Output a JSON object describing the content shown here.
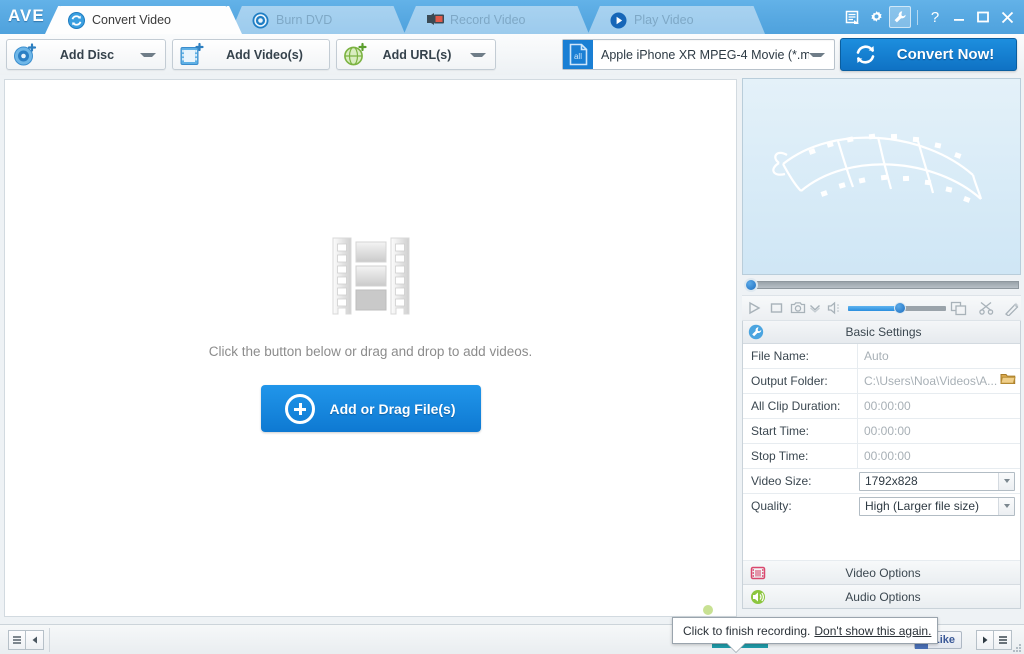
{
  "app": {
    "logo": "AVE"
  },
  "tabs": [
    {
      "label": "Convert Video",
      "icon": "convert-icon",
      "active": true
    },
    {
      "label": "Burn DVD",
      "icon": "disc-icon",
      "active": false
    },
    {
      "label": "Record Video",
      "icon": "camcorder-icon",
      "active": false
    },
    {
      "label": "Play Video",
      "icon": "play-icon",
      "active": false
    }
  ],
  "window_controls": [
    {
      "name": "log-icon",
      "glyph": "log"
    },
    {
      "name": "settings-gear-icon",
      "glyph": "gear"
    },
    {
      "name": "wrench-icon",
      "glyph": "wrench",
      "pressed": true
    },
    {
      "name": "help-icon",
      "glyph": "?"
    },
    {
      "name": "minimize-icon",
      "glyph": "—"
    },
    {
      "name": "maximize-icon",
      "glyph": "□"
    },
    {
      "name": "close-icon",
      "glyph": "✕"
    }
  ],
  "toolbar": {
    "add_disc": {
      "label": "Add Disc",
      "icon": "disc-plus-icon",
      "has_caret": true
    },
    "add_videos": {
      "label": "Add Video(s)",
      "icon": "film-plus-icon",
      "has_caret": false
    },
    "add_urls": {
      "label": "Add URL(s)",
      "icon": "globe-plus-icon",
      "has_caret": true
    },
    "format": {
      "value": "Apple iPhone XR MPEG-4 Movie (*.m...",
      "icon": "profile-all-icon"
    },
    "convert": {
      "label": "Convert Now!",
      "icon": "refresh-circle-icon"
    }
  },
  "dropzone": {
    "hint": "Click the button below or drag and drop to add videos.",
    "button_label": "Add or Drag File(s)",
    "icon": "film-strip-icon"
  },
  "preview": {
    "icon": "film-reel-watermark",
    "seek_position": 0,
    "controls": [
      {
        "name": "play-icon",
        "glyph": "play"
      },
      {
        "name": "stop-icon",
        "glyph": "stop"
      },
      {
        "name": "snapshot-icon",
        "glyph": "camera"
      },
      {
        "name": "snapshot-menu-icon",
        "glyph": "chevron-down"
      },
      {
        "name": "volume-icon",
        "glyph": "speaker"
      },
      {
        "name": "picture-in-picture-icon",
        "glyph": "pip"
      },
      {
        "name": "cut-icon",
        "glyph": "scissors"
      },
      {
        "name": "effects-icon",
        "glyph": "wand"
      }
    ],
    "volume": 52
  },
  "basic_settings": {
    "title": "Basic Settings",
    "icon": "wrench-screwdriver-icon",
    "rows": [
      {
        "label": "File Name:",
        "value": "Auto",
        "type": "text"
      },
      {
        "label": "Output Folder:",
        "value": "C:\\Users\\Noa\\Videos\\A...",
        "type": "folder"
      },
      {
        "label": "All Clip Duration:",
        "value": "00:00:00",
        "type": "text"
      },
      {
        "label": "Start Time:",
        "value": "00:00:00",
        "type": "text"
      },
      {
        "label": "Stop Time:",
        "value": "00:00:00",
        "type": "text"
      },
      {
        "label": "Video Size:",
        "value": "1792x828",
        "type": "combo"
      },
      {
        "label": "Quality:",
        "value": "High (Larger file size)",
        "type": "combo"
      }
    ]
  },
  "options": [
    {
      "label": "Video Options",
      "icon": "video-options-icon",
      "color": "#d9486e"
    },
    {
      "label": "Audio Options",
      "icon": "audio-options-icon",
      "color": "#8cc63f"
    }
  ],
  "statusbar": {
    "left_buttons": [
      {
        "name": "list-view-button",
        "glyph": "menu"
      },
      {
        "name": "collapse-panel-button",
        "glyph": "left"
      }
    ],
    "like": {
      "label": "Like",
      "icon": "thumbs-up-icon"
    },
    "right_buttons": [
      {
        "name": "play-queue-button",
        "glyph": "play"
      },
      {
        "name": "list-button",
        "glyph": "menu"
      }
    ]
  },
  "tooltip": {
    "text": "Click to finish recording.",
    "link": "Don't show this again."
  },
  "colors": {
    "titlebar": "#58a9e2",
    "accent_blue": "#0f79d2",
    "convert_blue": "#0f72c4",
    "panel_bg": "#eef2f5"
  }
}
